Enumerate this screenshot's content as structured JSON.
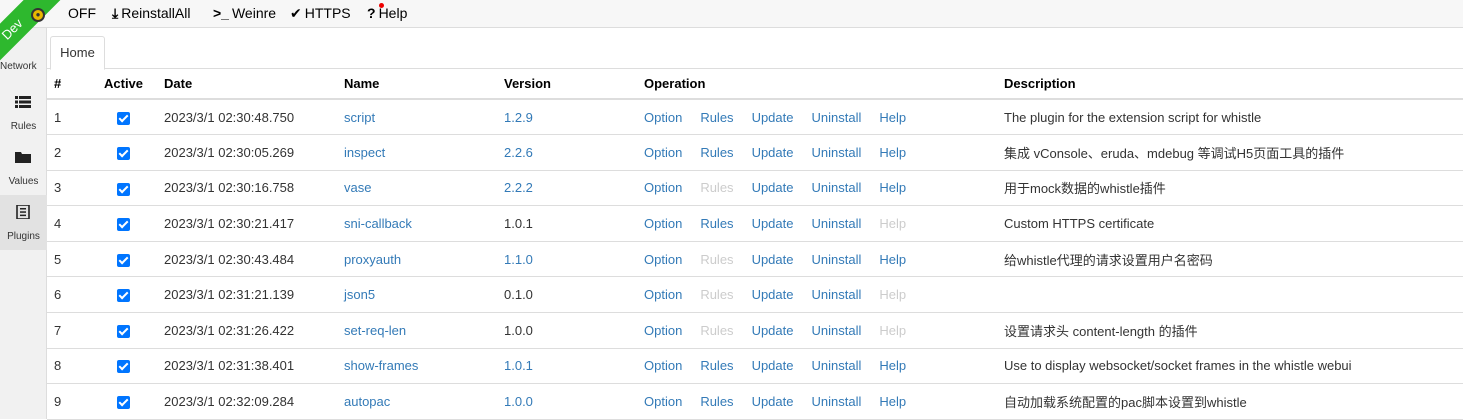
{
  "topbar": {
    "dev_label": "Dev",
    "off_label": "OFF",
    "reinstall_label": "ReinstallAll",
    "weinre_label": "Weinre",
    "https_label": "HTTPS",
    "help_label": "Help"
  },
  "sidebar": {
    "network_label": "Network",
    "rules_label": "Rules",
    "values_label": "Values",
    "plugins_label": "Plugins"
  },
  "tabs": {
    "home_label": "Home"
  },
  "table": {
    "headers": {
      "num": "#",
      "active": "Active",
      "date": "Date",
      "name": "Name",
      "version": "Version",
      "operation": "Operation",
      "description": "Description"
    },
    "op_labels": {
      "option": "Option",
      "rules": "Rules",
      "update": "Update",
      "uninstall": "Uninstall",
      "help": "Help"
    },
    "rows": [
      {
        "num": "1",
        "date": "2023/3/1 02:30:48.750",
        "name": "script",
        "version": "1.2.9",
        "version_link": true,
        "rules_enabled": true,
        "help_enabled": true,
        "description": "The plugin for the extension script for whistle"
      },
      {
        "num": "2",
        "date": "2023/3/1 02:30:05.269",
        "name": "inspect",
        "version": "2.2.6",
        "version_link": true,
        "rules_enabled": true,
        "help_enabled": true,
        "description": "集成 vConsole、eruda、mdebug 等调试H5页面工具的插件"
      },
      {
        "num": "3",
        "date": "2023/3/1 02:30:16.758",
        "name": "vase",
        "version": "2.2.2",
        "version_link": true,
        "rules_enabled": false,
        "help_enabled": true,
        "description": "用于mock数据的whistle插件"
      },
      {
        "num": "4",
        "date": "2023/3/1 02:30:21.417",
        "name": "sni-callback",
        "version": "1.0.1",
        "version_link": false,
        "rules_enabled": true,
        "help_enabled": false,
        "description": "Custom HTTPS certificate"
      },
      {
        "num": "5",
        "date": "2023/3/1 02:30:43.484",
        "name": "proxyauth",
        "version": "1.1.0",
        "version_link": true,
        "rules_enabled": false,
        "help_enabled": true,
        "description": "给whistle代理的请求设置用户名密码"
      },
      {
        "num": "6",
        "date": "2023/3/1 02:31:21.139",
        "name": "json5",
        "version": "0.1.0",
        "version_link": false,
        "rules_enabled": false,
        "help_enabled": false,
        "description": ""
      },
      {
        "num": "7",
        "date": "2023/3/1 02:31:26.422",
        "name": "set-req-len",
        "version": "1.0.0",
        "version_link": false,
        "rules_enabled": false,
        "help_enabled": false,
        "description": "设置请求头 content-length 的插件"
      },
      {
        "num": "8",
        "date": "2023/3/1 02:31:38.401",
        "name": "show-frames",
        "version": "1.0.1",
        "version_link": true,
        "rules_enabled": true,
        "help_enabled": true,
        "description": "Use to display websocket/socket frames in the whistle webui"
      },
      {
        "num": "9",
        "date": "2023/3/1 02:32:09.284",
        "name": "autopac",
        "version": "1.0.0",
        "version_link": true,
        "rules_enabled": true,
        "help_enabled": true,
        "description": "自动加载系统配置的pac脚本设置到whistle"
      }
    ]
  },
  "colors": {
    "link": "#337ab7",
    "disabled": "#cccccc",
    "checkbox": "#0075ff",
    "ribbon": "#2eb82e"
  }
}
